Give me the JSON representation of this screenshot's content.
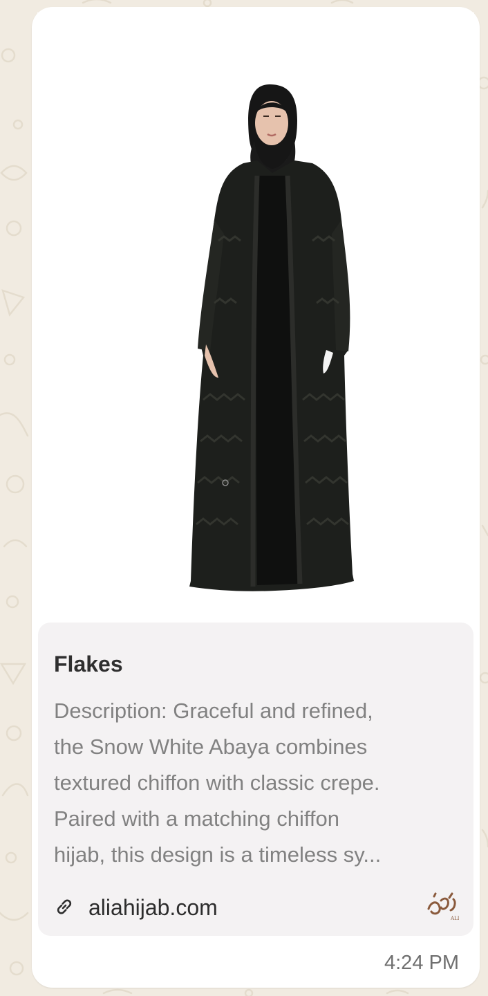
{
  "preview": {
    "title": "Flakes",
    "description_lines": [
      "Description: Graceful and refined,",
      "the Snow White Abaya combines",
      "textured chiffon with classic crepe.",
      "Paired with a matching chiffon",
      "hijab, this design is a timeless sy..."
    ],
    "link_text": "aliahijab.com",
    "link_icon": "link-icon",
    "site_logo": "aliahijab-logo"
  },
  "message": {
    "time": "4:24 PM"
  },
  "colors": {
    "wallpaper": "#f1ebe1",
    "bubble": "#ffffff",
    "card": "#f4f2f3",
    "logo_brown": "#8a5a3c"
  }
}
